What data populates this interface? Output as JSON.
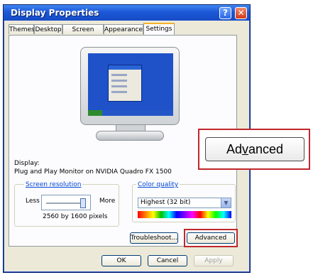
{
  "window": {
    "title": "Display Properties",
    "help_glyph": "?",
    "close_glyph": "✕"
  },
  "tabs": [
    {
      "label": "Themes"
    },
    {
      "label": "Desktop"
    },
    {
      "label": "Screen Saver"
    },
    {
      "label": "Appearance"
    },
    {
      "label": "Settings"
    }
  ],
  "display": {
    "label": "Display:",
    "value": "Plug and Play Monitor on NVIDIA Quadro FX 1500"
  },
  "screen_resolution": {
    "label": "Screen resolution",
    "less": "Less",
    "more": "More",
    "value_text": "2560 by 1600 pixels",
    "slider_level": 1.0
  },
  "color_quality": {
    "label": "Color quality",
    "selected": "Highest (32 bit)",
    "arrow": "▼"
  },
  "buttons": {
    "troubleshoot": "Troubleshoot...",
    "advanced": "Advanced",
    "ok": "OK",
    "cancel": "Cancel",
    "apply": "Apply"
  },
  "zoom_callout": {
    "label_before": "Ad",
    "label_underlined": "v",
    "label_after": "anced"
  }
}
